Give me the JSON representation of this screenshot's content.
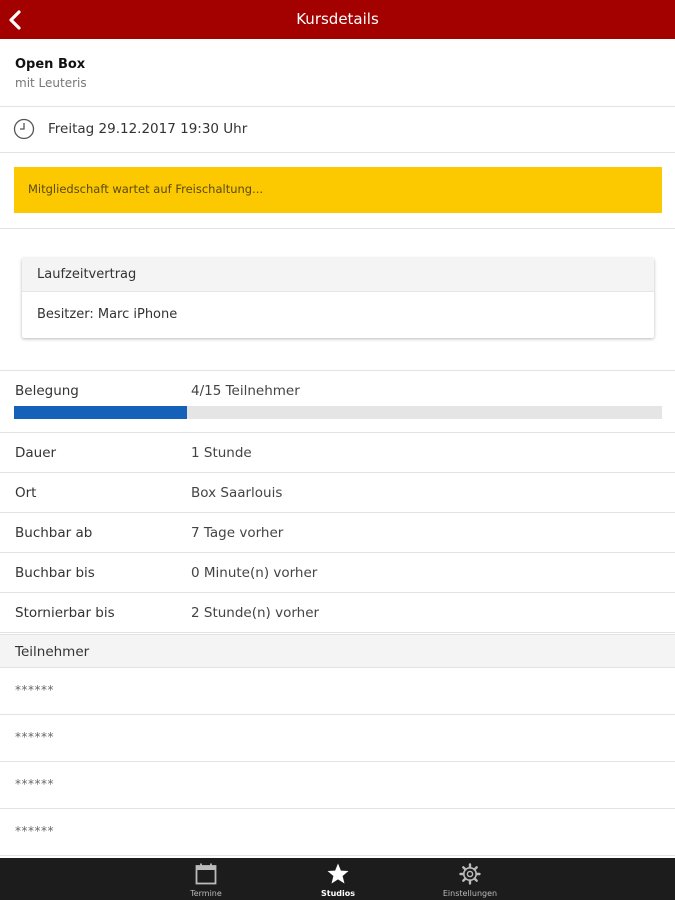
{
  "header": {
    "title": "Kursdetails",
    "back_icon": "chevron-left-icon"
  },
  "course": {
    "name": "Open Box",
    "trainer": "mit Leuteris"
  },
  "schedule": {
    "icon": "clock-icon",
    "datetime": "Freitag 29.12.2017 19:30 Uhr"
  },
  "notice": {
    "text": "Mitgliedschaft wartet auf Freischaltung...",
    "color": "#fcc800"
  },
  "contract": {
    "title": "Laufzeitvertrag",
    "owner": "Besitzer: Marc iPhone"
  },
  "occupancy": {
    "label": "Belegung",
    "value": "4/15 Teilnehmer",
    "booked": 4,
    "capacity": 15,
    "bar_color": "#1560b8"
  },
  "details": [
    {
      "label": "Dauer",
      "value": "1 Stunde"
    },
    {
      "label": "Ort",
      "value": "Box Saarlouis"
    },
    {
      "label": "Buchbar ab",
      "value": "7 Tage vorher"
    },
    {
      "label": "Buchbar bis",
      "value": "0 Minute(n) vorher"
    },
    {
      "label": "Stornierbar bis",
      "value": "2 Stunde(n) vorher"
    }
  ],
  "participants": {
    "title": "Teilnehmer",
    "items": [
      "******",
      "******",
      "******",
      "******"
    ]
  },
  "tabs": [
    {
      "label": "Termine",
      "icon": "calendar-icon",
      "active": false
    },
    {
      "label": "Studios",
      "icon": "star-icon",
      "active": true
    },
    {
      "label": "Einstellungen",
      "icon": "gear-icon",
      "active": false
    }
  ],
  "colors": {
    "header": "#a30000",
    "tabbar": "#1c1c1c"
  }
}
